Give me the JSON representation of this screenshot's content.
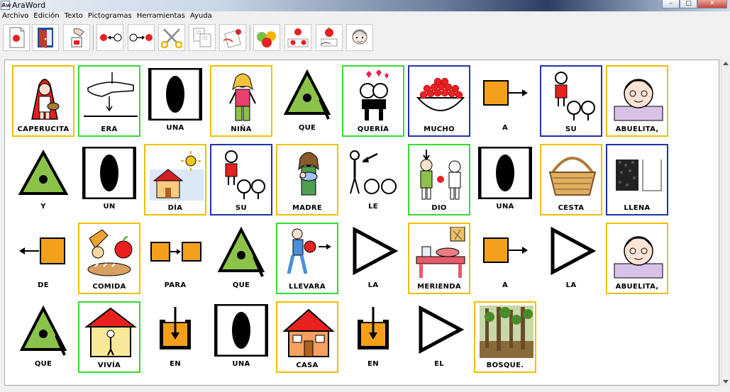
{
  "window": {
    "title": "AraWord",
    "app_icon_text": "Aw",
    "controls": [
      "–",
      "□",
      "✕"
    ]
  },
  "menu": [
    "Archivo",
    "Edición",
    "Texto",
    "Pictogramas",
    "Herramientas",
    "Ayuda"
  ],
  "toolbar": {
    "buttons": [
      {
        "name": "new-document",
        "icon": "new-document-icon"
      },
      {
        "name": "open-document",
        "icon": "open-door-icon"
      },
      {
        "name": "save-document",
        "icon": "save-hand-icon"
      },
      {
        "name": "pictogram-left",
        "icon": "pictogram-left-icon"
      },
      {
        "name": "pictogram-right",
        "icon": "pictogram-right-icon"
      },
      {
        "name": "cut",
        "icon": "scissors-icon"
      },
      {
        "name": "copy",
        "icon": "copy-icon"
      },
      {
        "name": "paste",
        "icon": "paste-icon"
      },
      {
        "name": "change-pictogram",
        "icon": "apples-icon"
      },
      {
        "name": "pictogram-options",
        "icon": "apple-arrows-icon"
      },
      {
        "name": "edit-pictogram",
        "icon": "apple-hand-icon"
      },
      {
        "name": "face-settings",
        "icon": "face-icon"
      }
    ]
  },
  "document": {
    "rows": [
      [
        {
          "label": "CAPERUCITA",
          "border": "#f0c000",
          "icon": "little-red-riding-hood"
        },
        {
          "label": "ERA",
          "border": "#33dd33",
          "icon": "hand-point-down"
        },
        {
          "label": "UNA",
          "border": "none",
          "icon": "black-oval-frame"
        },
        {
          "label": "NIÑA",
          "border": "#f0c000",
          "icon": "girl"
        },
        {
          "label": "QUE",
          "border": "none",
          "icon": "green-triangle-dot"
        },
        {
          "label": "QUERÍA",
          "border": "#33dd33",
          "icon": "kissing-couple"
        },
        {
          "label": "MUCHO",
          "border": "#2233aa",
          "icon": "bowl-of-berries"
        },
        {
          "label": "A",
          "border": "none",
          "icon": "square-arrow-right"
        },
        {
          "label": "SU",
          "border": "#2233aa",
          "icon": "possessive-person"
        },
        {
          "label": "ABUELITA,",
          "border": "#f0c000",
          "icon": "grandmother"
        }
      ],
      [
        {
          "label": "Y",
          "border": "none",
          "icon": "green-triangle"
        },
        {
          "label": "UN",
          "border": "none",
          "icon": "black-oval-frame"
        },
        {
          "label": "DÍA",
          "border": "#f0c000",
          "icon": "house-sun"
        },
        {
          "label": "SU",
          "border": "#2233aa",
          "icon": "possessive-person"
        },
        {
          "label": "MADRE",
          "border": "#f0c000",
          "icon": "mother-baby"
        },
        {
          "label": "LE",
          "border": "none",
          "icon": "stick-person-arrow"
        },
        {
          "label": "DIO",
          "border": "#33dd33",
          "icon": "give-apple"
        },
        {
          "label": "UNA",
          "border": "none",
          "icon": "black-oval-frame"
        },
        {
          "label": "CESTA",
          "border": "#f0c000",
          "icon": "basket"
        },
        {
          "label": "LLENA",
          "border": "#2233aa",
          "icon": "full-container"
        }
      ],
      [
        {
          "label": "DE",
          "border": "none",
          "icon": "arrow-left-square"
        },
        {
          "label": "COMIDA",
          "border": "#f0c000",
          "icon": "food"
        },
        {
          "label": "PARA",
          "border": "none",
          "icon": "square-to-square"
        },
        {
          "label": "QUE",
          "border": "none",
          "icon": "green-triangle-dot"
        },
        {
          "label": "LLEVARA",
          "border": "#33dd33",
          "icon": "carry-ball"
        },
        {
          "label": "LA",
          "border": "none",
          "icon": "outline-triangle"
        },
        {
          "label": "MERIENDA",
          "border": "#f0c000",
          "icon": "snack-table"
        },
        {
          "label": "A",
          "border": "none",
          "icon": "square-arrow-right"
        },
        {
          "label": "LA",
          "border": "none",
          "icon": "outline-triangle"
        },
        {
          "label": "ABUELITA,",
          "border": "#f0c000",
          "icon": "grandmother"
        }
      ],
      [
        {
          "label": "QUE",
          "border": "none",
          "icon": "green-triangle-dot"
        },
        {
          "label": "VIVÍA",
          "border": "#33dd33",
          "icon": "person-in-house"
        },
        {
          "label": "EN",
          "border": "none",
          "icon": "arrow-into-box"
        },
        {
          "label": "UNA",
          "border": "none",
          "icon": "black-oval-frame"
        },
        {
          "label": "CASA",
          "border": "#f0c000",
          "icon": "house"
        },
        {
          "label": "EN",
          "border": "none",
          "icon": "arrow-into-box"
        },
        {
          "label": "EL",
          "border": "none",
          "icon": "outline-triangle"
        },
        {
          "label": "BOSQUE.",
          "border": "#f0c000",
          "icon": "forest"
        }
      ]
    ]
  }
}
